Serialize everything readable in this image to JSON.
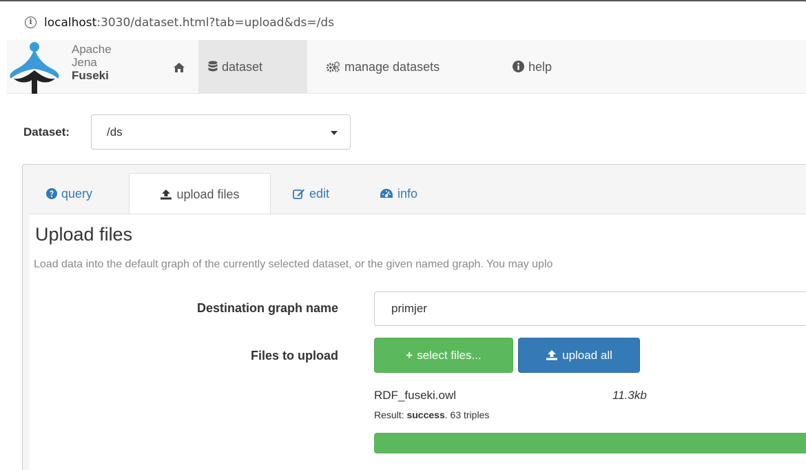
{
  "browser": {
    "url_host": "localhost",
    "url_rest": ":3030/dataset.html?tab=upload&ds=/ds"
  },
  "navbar": {
    "brand_line1": "Apache",
    "brand_line2": "Jena",
    "brand_line3": "Fuseki",
    "items": [
      {
        "label": "",
        "icon": "home-icon"
      },
      {
        "label": "dataset",
        "icon": "database-icon",
        "active": true
      },
      {
        "label": "manage datasets",
        "icon": "cogs-icon"
      },
      {
        "label": "help",
        "icon": "info-circle-icon"
      }
    ]
  },
  "dataset_selector": {
    "label": "Dataset:",
    "selected": "/ds"
  },
  "tabs": [
    {
      "label": "query",
      "icon": "question-circle-icon"
    },
    {
      "label": "upload files",
      "icon": "upload-icon",
      "active": true
    },
    {
      "label": "edit",
      "icon": "edit-icon"
    },
    {
      "label": "info",
      "icon": "dashboard-icon"
    }
  ],
  "upload": {
    "title": "Upload files",
    "description": "Load data into the default graph of the currently selected dataset, or the given named graph. You may uplo",
    "dest_label": "Destination graph name",
    "dest_value": "primjer",
    "files_label": "Files to upload",
    "select_button": "select files...",
    "upload_button": "upload all",
    "file": {
      "name": "RDF_fuseki.owl",
      "size": "11.3kb",
      "result_prefix": "Result: ",
      "result_status": "success",
      "result_suffix": ". 63 triples",
      "progress": 1.0
    }
  },
  "colors": {
    "success": "#5cb85c",
    "primary": "#337ab7",
    "logo_blue": "#3a9bd9",
    "logo_dark": "#222222"
  }
}
